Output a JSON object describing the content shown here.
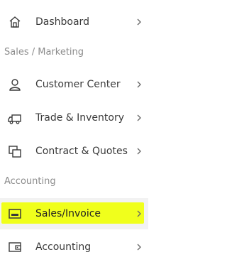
{
  "menu": {
    "items": [
      {
        "label": "Dashboard",
        "icon": "home-icon"
      },
      {
        "label": "Customer Center",
        "icon": "user-icon"
      },
      {
        "label": "Trade & Inventory",
        "icon": "truck-icon"
      },
      {
        "label": "Contract & Quotes",
        "icon": "documents-icon"
      },
      {
        "label": "Sales/Invoice",
        "icon": "invoice-icon",
        "active": true
      },
      {
        "label": "Accounting",
        "icon": "wallet-icon"
      }
    ],
    "sections": [
      {
        "label": "Sales / Marketing"
      },
      {
        "label": "Accounting"
      }
    ]
  },
  "colors": {
    "highlight": "#f0ff1c",
    "text": "#3a3a3a",
    "section_text": "#8c8c8c"
  }
}
